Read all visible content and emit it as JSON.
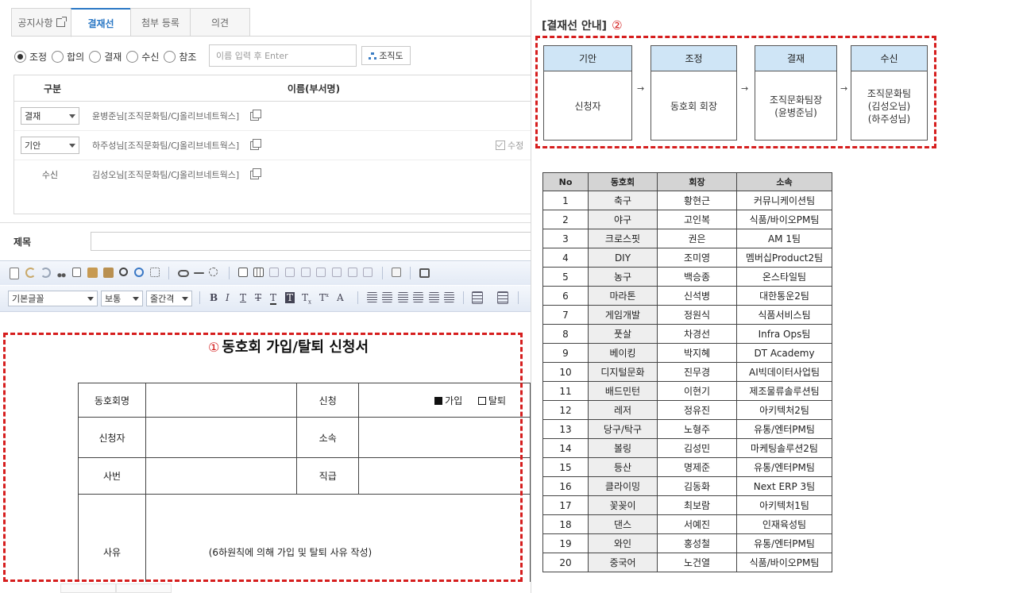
{
  "tabs": [
    {
      "label": "공지사항",
      "active": false,
      "icon": "external-link-icon"
    },
    {
      "label": "결재선",
      "active": true
    },
    {
      "label": "첨부 등록",
      "active": false
    },
    {
      "label": "의견",
      "active": false
    }
  ],
  "radios": [
    {
      "label": "조정",
      "checked": true
    },
    {
      "label": "합의",
      "checked": false
    },
    {
      "label": "결재",
      "checked": false
    },
    {
      "label": "수신",
      "checked": false
    },
    {
      "label": "참조",
      "checked": false
    }
  ],
  "search": {
    "placeholder": "이름 입력 후 Enter",
    "org_button": "조직도"
  },
  "approval_line": {
    "header": {
      "type": "구분",
      "name": "이름(부서명)"
    },
    "rows": [
      {
        "role": "결재",
        "person": "윤병준님[조직문화팀/CJ올리브네트웍스]"
      },
      {
        "role": "기안",
        "person": "하주성님[조직문화팀/CJ올리브네트웍스]",
        "extra": "수정"
      },
      {
        "role": "수신",
        "person": "김성오님[조직문화팀/CJ올리브네트웍스]"
      }
    ]
  },
  "subject": {
    "label": "제목",
    "value": ""
  },
  "editor": {
    "font_select": "기본글꼴",
    "size_select": "보통",
    "spacing_select": "줄간격"
  },
  "document": {
    "marker": "①",
    "title": "동호회 가입/탈퇴 신청서",
    "row1": {
      "label": "동호회명",
      "label2": "신청",
      "option_join": "가입",
      "option_leave": "탈퇴"
    },
    "row2": {
      "label": "신청자",
      "label2": "소속"
    },
    "row3": {
      "label": "사번",
      "label2": "직급"
    },
    "row4": {
      "label": "사유",
      "note": "(6하원칙에 의해 가입 및 탈퇴 사유 작성)"
    }
  },
  "guide": {
    "title": "[결재선 안내]",
    "marker": "②",
    "flow": [
      {
        "head": "기안",
        "body": "신청자"
      },
      {
        "head": "조정",
        "body": "동호회 회장"
      },
      {
        "head": "결재",
        "body": "조직문화팀장\n(윤병준님)"
      },
      {
        "head": "수신",
        "body": "조직문화팀\n(김성오님)\n(하주성님)"
      }
    ],
    "arrow": "→"
  },
  "clubs": {
    "headers": [
      "No",
      "동호회",
      "회장",
      "소속"
    ],
    "rows": [
      [
        "1",
        "축구",
        "황현근",
        "커뮤니케이션팀"
      ],
      [
        "2",
        "야구",
        "고인복",
        "식품/바이오PM팀"
      ],
      [
        "3",
        "크로스핏",
        "권은",
        "AM 1팀"
      ],
      [
        "4",
        "DIY",
        "조미영",
        "멤버십Product2팀"
      ],
      [
        "5",
        "농구",
        "백승종",
        "온스타일팀"
      ],
      [
        "6",
        "마라톤",
        "신석병",
        "대한통운2팀"
      ],
      [
        "7",
        "게임개발",
        "정원식",
        "식품서비스팀"
      ],
      [
        "8",
        "풋살",
        "차경선",
        "Infra Ops팀"
      ],
      [
        "9",
        "베이킹",
        "박지혜",
        "DT Academy"
      ],
      [
        "10",
        "디지털문화",
        "진무경",
        "AI빅데이터사업팀"
      ],
      [
        "11",
        "배드민턴",
        "이현기",
        "제조물류솔루션팀"
      ],
      [
        "12",
        "레저",
        "정유진",
        "아키텍처2팀"
      ],
      [
        "13",
        "당구/탁구",
        "노형주",
        "유통/엔터PM팀"
      ],
      [
        "14",
        "볼링",
        "김성민",
        "마케팅솔루션2팀"
      ],
      [
        "15",
        "등산",
        "명제준",
        "유통/엔터PM팀"
      ],
      [
        "16",
        "클라이밍",
        "김동화",
        "Next ERP 3팀"
      ],
      [
        "17",
        "꽃꽂이",
        "최보람",
        "아키텍처1팀"
      ],
      [
        "18",
        "댄스",
        "서예진",
        "인재육성팀"
      ],
      [
        "19",
        "와인",
        "홍성철",
        "유통/엔터PM팀"
      ],
      [
        "20",
        "중국어",
        "노건열",
        "식품/바이오PM팀"
      ]
    ]
  },
  "colors": {
    "accent": "#2b78c5",
    "highlight_dash": "#d61e1e",
    "flow_header": "#cfe5f6"
  }
}
